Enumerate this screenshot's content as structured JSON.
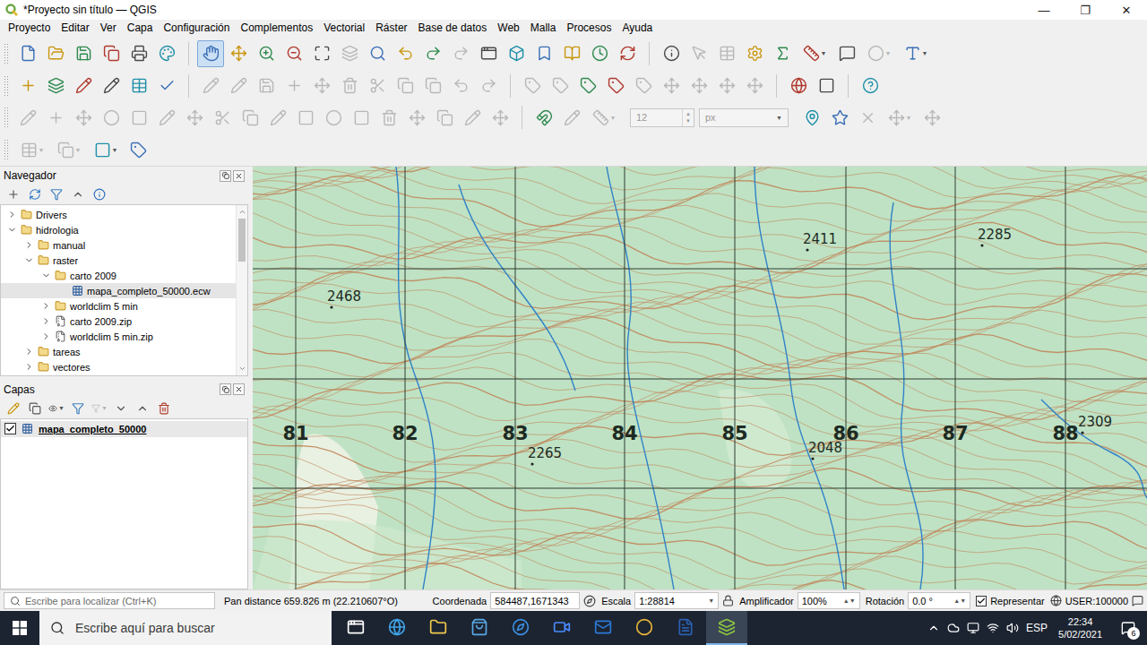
{
  "window": {
    "title": "*Proyecto sin título — QGIS",
    "controls": [
      "—",
      "❐",
      "✕"
    ]
  },
  "menu": [
    "Proyecto",
    "Editar",
    "Ver",
    "Capa",
    "Configuración",
    "Complementos",
    "Vectorial",
    "Ráster",
    "Base de datos",
    "Web",
    "Malla",
    "Procesos",
    "Ayuda"
  ],
  "toolbars": [
    {
      "items": [
        {
          "kind": "button",
          "disabled": false,
          "selected": false
        },
        {
          "kind": "button",
          "disabled": false,
          "selected": false
        },
        {
          "kind": "button",
          "disabled": false,
          "selected": false
        },
        {
          "kind": "button",
          "disabled": false,
          "selected": false
        },
        {
          "kind": "button",
          "disabled": false,
          "selected": false
        },
        {
          "kind": "button",
          "disabled": false,
          "selected": false
        },
        {
          "kind": "separator"
        },
        {
          "kind": "button",
          "disabled": false,
          "selected": true
        },
        {
          "kind": "button",
          "disabled": false,
          "selected": false
        },
        {
          "kind": "button",
          "disabled": false,
          "selected": false
        },
        {
          "kind": "button",
          "disabled": false,
          "selected": false
        },
        {
          "kind": "button",
          "disabled": false,
          "selected": false
        },
        {
          "kind": "button",
          "disabled": true,
          "selected": false
        },
        {
          "kind": "button",
          "disabled": false,
          "selected": false
        },
        {
          "kind": "button",
          "disabled": false,
          "selected": false
        },
        {
          "kind": "button",
          "disabled": false,
          "selected": false
        },
        {
          "kind": "button",
          "disabled": true,
          "selected": false
        },
        {
          "kind": "button",
          "disabled": false,
          "selected": false
        },
        {
          "kind": "button",
          "disabled": false,
          "selected": false
        },
        {
          "kind": "button",
          "disabled": false,
          "selected": false
        },
        {
          "kind": "button",
          "disabled": false,
          "selected": false
        },
        {
          "kind": "button",
          "disabled": false,
          "selected": false
        },
        {
          "kind": "button",
          "disabled": false,
          "selected": false
        },
        {
          "kind": "separator"
        },
        {
          "kind": "button",
          "disabled": false,
          "selected": false
        },
        {
          "kind": "button",
          "disabled": true,
          "selected": false
        },
        {
          "kind": "button",
          "disabled": true,
          "selected": false
        },
        {
          "kind": "button",
          "disabled": false,
          "selected": false
        },
        {
          "kind": "button",
          "disabled": false,
          "selected": false
        },
        {
          "kind": "menubutton",
          "disabled": false,
          "selected": false
        },
        {
          "kind": "button",
          "disabled": false,
          "selected": false
        },
        {
          "kind": "menubutton",
          "disabled": true,
          "selected": false
        },
        {
          "kind": "menubutton",
          "disabled": false,
          "selected": false
        }
      ]
    },
    {
      "items": [
        {
          "kind": "button",
          "disabled": false,
          "selected": false
        },
        {
          "kind": "button",
          "disabled": false,
          "selected": false
        },
        {
          "kind": "button",
          "disabled": false,
          "selected": false
        },
        {
          "kind": "button",
          "disabled": false,
          "selected": false
        },
        {
          "kind": "button",
          "disabled": false,
          "selected": false
        },
        {
          "kind": "button",
          "disabled": false,
          "selected": false
        },
        {
          "kind": "separator"
        },
        {
          "kind": "button",
          "disabled": true,
          "selected": false
        },
        {
          "kind": "button",
          "disabled": true,
          "selected": false
        },
        {
          "kind": "button",
          "disabled": true,
          "selected": false
        },
        {
          "kind": "button",
          "disabled": true,
          "selected": false
        },
        {
          "kind": "button",
          "disabled": true,
          "selected": false
        },
        {
          "kind": "button",
          "disabled": true,
          "selected": false
        },
        {
          "kind": "button",
          "disabled": true,
          "selected": false
        },
        {
          "kind": "button",
          "disabled": true,
          "selected": false
        },
        {
          "kind": "button",
          "disabled": true,
          "selected": false
        },
        {
          "kind": "button",
          "disabled": true,
          "selected": false
        },
        {
          "kind": "button",
          "disabled": true,
          "selected": false
        },
        {
          "kind": "separator"
        },
        {
          "kind": "button",
          "disabled": true,
          "selected": false
        },
        {
          "kind": "button",
          "disabled": true,
          "selected": false
        },
        {
          "kind": "button",
          "disabled": false,
          "selected": false
        },
        {
          "kind": "button",
          "disabled": false,
          "selected": false
        },
        {
          "kind": "button",
          "disabled": true,
          "selected": false
        },
        {
          "kind": "button",
          "disabled": true,
          "selected": false
        },
        {
          "kind": "button",
          "disabled": true,
          "selected": false
        },
        {
          "kind": "button",
          "disabled": true,
          "selected": false
        },
        {
          "kind": "button",
          "disabled": true,
          "selected": false
        },
        {
          "kind": "separator"
        },
        {
          "kind": "button",
          "disabled": false,
          "selected": false
        },
        {
          "kind": "button",
          "disabled": false,
          "selected": false
        },
        {
          "kind": "separator"
        },
        {
          "kind": "button",
          "disabled": false,
          "selected": false
        }
      ]
    },
    {
      "items": [
        {
          "kind": "button",
          "disabled": true,
          "selected": false
        },
        {
          "kind": "button",
          "disabled": true,
          "selected": false
        },
        {
          "kind": "button",
          "disabled": true,
          "selected": false
        },
        {
          "kind": "button",
          "disabled": true,
          "selected": false
        },
        {
          "kind": "button",
          "disabled": true,
          "selected": false
        },
        {
          "kind": "button",
          "disabled": true,
          "selected": false
        },
        {
          "kind": "button",
          "disabled": true,
          "selected": false
        },
        {
          "kind": "button",
          "disabled": true,
          "selected": false
        },
        {
          "kind": "button",
          "disabled": true,
          "selected": false
        },
        {
          "kind": "button",
          "disabled": true,
          "selected": false
        },
        {
          "kind": "button",
          "disabled": true,
          "selected": false
        },
        {
          "kind": "button",
          "disabled": true,
          "selected": false
        },
        {
          "kind": "button",
          "disabled": true,
          "selected": false
        },
        {
          "kind": "button",
          "disabled": true,
          "selected": false
        },
        {
          "kind": "button",
          "disabled": true,
          "selected": false
        },
        {
          "kind": "button",
          "disabled": true,
          "selected": false
        },
        {
          "kind": "button",
          "disabled": true,
          "selected": false
        },
        {
          "kind": "button",
          "disabled": true,
          "selected": false
        },
        {
          "kind": "separator"
        },
        {
          "kind": "button",
          "disabled": false,
          "selected": false
        },
        {
          "kind": "button",
          "disabled": true,
          "selected": false
        },
        {
          "kind": "menubutton",
          "disabled": true,
          "selected": false
        },
        {
          "kind": "spin",
          "value": "12"
        },
        {
          "kind": "combo",
          "value": "px"
        },
        {
          "kind": "button",
          "disabled": false,
          "selected": false
        },
        {
          "kind": "button",
          "disabled": false,
          "selected": false
        },
        {
          "kind": "button",
          "disabled": true,
          "selected": false
        },
        {
          "kind": "menubutton",
          "disabled": true,
          "selected": false
        },
        {
          "kind": "button",
          "disabled": true,
          "selected": false
        }
      ]
    },
    {
      "items": [
        {
          "kind": "menubutton",
          "disabled": true,
          "selected": false
        },
        {
          "kind": "menubutton",
          "disabled": true,
          "selected": false
        },
        {
          "kind": "menubutton",
          "disabled": false,
          "selected": false
        },
        {
          "kind": "button",
          "disabled": false,
          "selected": false
        }
      ]
    }
  ],
  "navigator": {
    "title": "Navegador",
    "scrollbar": {
      "level": 0.3
    },
    "items": [
      {
        "label": "Drivers",
        "kind": "folder",
        "depth": 1,
        "expanded": false,
        "expandable": true,
        "selected": false
      },
      {
        "label": "hidrologia",
        "kind": "folder",
        "depth": 1,
        "expanded": true,
        "expandable": true,
        "selected": false
      },
      {
        "label": "manual",
        "kind": "folder",
        "depth": 2,
        "expanded": false,
        "expandable": true,
        "selected": false
      },
      {
        "label": "raster",
        "kind": "folder",
        "depth": 2,
        "expanded": true,
        "expandable": true,
        "selected": false
      },
      {
        "label": "carto 2009",
        "kind": "folder",
        "depth": 3,
        "expanded": true,
        "expandable": true,
        "selected": false
      },
      {
        "label": "mapa_completo_50000.ecw",
        "kind": "raster",
        "depth": 4,
        "expanded": false,
        "expandable": false,
        "selected": true
      },
      {
        "label": "worldclim 5 min",
        "kind": "folder",
        "depth": 3,
        "expanded": false,
        "expandable": true,
        "selected": false
      },
      {
        "label": "carto 2009.zip",
        "kind": "zip",
        "depth": 3,
        "expanded": false,
        "expandable": true,
        "selected": false
      },
      {
        "label": "worldclim 5 min.zip",
        "kind": "zip",
        "depth": 3,
        "expanded": false,
        "expandable": true,
        "selected": false
      },
      {
        "label": "tareas",
        "kind": "folder",
        "depth": 2,
        "expanded": false,
        "expandable": true,
        "selected": false
      },
      {
        "label": "vectores",
        "kind": "folder",
        "depth": 2,
        "expanded": false,
        "expandable": true,
        "selected": false
      }
    ]
  },
  "layers": {
    "title": "Capas",
    "items": [
      {
        "name": "mapa_completo_50000",
        "checked": true,
        "selected": true
      }
    ]
  },
  "map": {
    "grid_labels": [
      "81",
      "82",
      "83",
      "84",
      "85",
      "86",
      "87",
      "88"
    ],
    "spot_heights": [
      "2468",
      "2411",
      "2285",
      "2265",
      "2048",
      "2309"
    ]
  },
  "status": {
    "search_placeholder": "Escribe para localizar (Ctrl+K)",
    "message": "Pan distance 659.826 m (22.210607°O)",
    "coordinate_label": "Coordenada",
    "coordinate": "584487,1671343",
    "scale_label": "Escala",
    "scale": "1:28814",
    "magnifier_label": "Amplificador",
    "magnifier": "100%",
    "rotation_label": "Rotación",
    "rotation": "0.0 °",
    "render_label": "Representar",
    "render_checked": true,
    "crs": "USER:100000"
  },
  "taskbar": {
    "search_placeholder": "Escribe aquí para buscar",
    "apps": [
      {
        "active": false
      },
      {
        "active": false
      },
      {
        "active": false
      },
      {
        "active": false
      },
      {
        "active": false
      },
      {
        "active": false
      },
      {
        "active": false
      },
      {
        "active": false
      },
      {
        "active": false
      },
      {
        "active": true
      }
    ],
    "language": "ESP",
    "time": "22:34",
    "date": "5/02/2021",
    "notifications": "6"
  }
}
